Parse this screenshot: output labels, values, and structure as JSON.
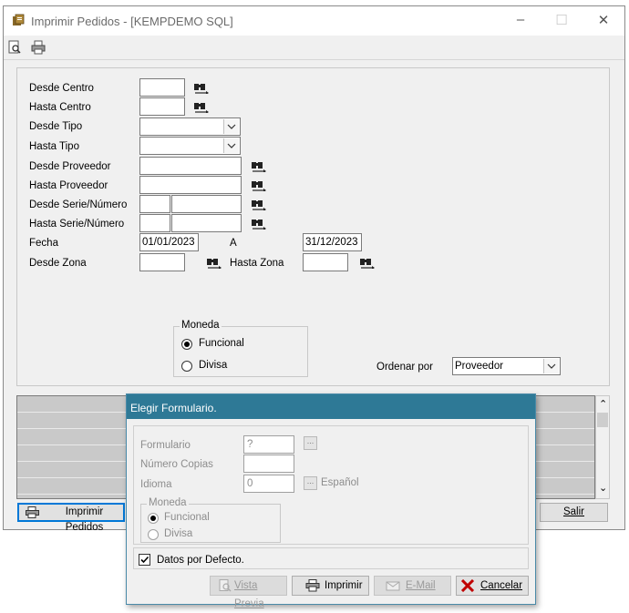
{
  "window": {
    "title": "Imprimir Pedidos  - [KEMPDEMO SQL]",
    "minimize_glyph": "–",
    "maximize_glyph": "☐",
    "close_glyph": "✕"
  },
  "toolbar": {
    "icons": [
      "preview-icon",
      "printer-icon"
    ]
  },
  "form": {
    "desde_centro": {
      "label": "Desde Centro",
      "value": ""
    },
    "hasta_centro": {
      "label": "Hasta Centro",
      "value": ""
    },
    "desde_tipo": {
      "label": "Desde Tipo",
      "value": ""
    },
    "hasta_tipo": {
      "label": "Hasta Tipo",
      "value": ""
    },
    "desde_proveedor": {
      "label": "Desde Proveedor",
      "value": ""
    },
    "hasta_proveedor": {
      "label": "Hasta Proveedor",
      "value": ""
    },
    "desde_serie": {
      "label": "Desde Serie/Número",
      "serie": "",
      "numero": ""
    },
    "hasta_serie": {
      "label": "Hasta Serie/Número",
      "serie": "",
      "numero": ""
    },
    "fecha": {
      "label": "Fecha",
      "from": "01/01/2023",
      "to_label": "A",
      "to": "31/12/2023"
    },
    "desde_zona": {
      "label": "Desde Zona",
      "value": ""
    },
    "hasta_zona": {
      "label": "Hasta Zona",
      "value": ""
    },
    "moneda": {
      "title": "Moneda",
      "options": [
        "Funcional",
        "Divisa"
      ],
      "selected": "Funcional"
    },
    "ordenar_por": {
      "label": "Ordenar por",
      "value": "Proveedor"
    }
  },
  "buttons": {
    "imprimir_pedidos": "Imprimir Pedidos",
    "salir": "Salir"
  },
  "scroll": {
    "up": "⌃",
    "down": "⌄"
  },
  "dialog": {
    "title": "Elegir Formulario.",
    "formulario": {
      "label": "Formulario",
      "value": "?"
    },
    "numero_copias": {
      "label": "Número Copias",
      "value": ""
    },
    "idioma": {
      "label": "Idioma",
      "value": "0",
      "name": "Español"
    },
    "ellipsis": "...",
    "moneda": {
      "title": "Moneda",
      "options": [
        "Funcional",
        "Divisa"
      ],
      "selected": "Funcional"
    },
    "datos_por_defecto": {
      "label": "Datos por Defecto.",
      "checked": true
    },
    "buttons": {
      "vista_previa": "Vista Previa",
      "imprimir": "Imprimir",
      "email": "E-Mail",
      "cancelar": "Cancelar"
    }
  }
}
